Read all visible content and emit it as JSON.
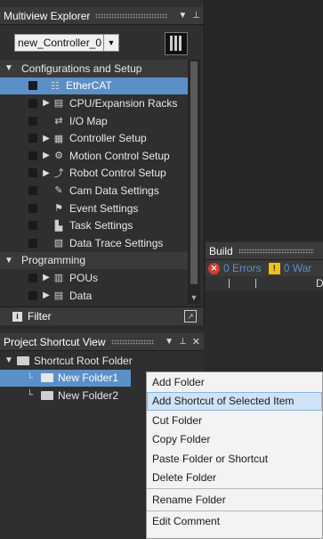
{
  "multiview": {
    "title": "Multiview Explorer",
    "controller_select": "new_Controller_0",
    "items": [
      {
        "label": "Configurations and Setup",
        "kind": "section",
        "arrow": "▼"
      },
      {
        "label": "EtherCAT",
        "kind": "item",
        "icon": "ethercat-icon",
        "glyph": "☷",
        "selected": true
      },
      {
        "label": "CPU/Expansion Racks",
        "kind": "item",
        "icon": "rack-icon",
        "glyph": "▤",
        "arrow": "▶"
      },
      {
        "label": "I/O Map",
        "kind": "item",
        "icon": "io-map-icon",
        "glyph": "⇄"
      },
      {
        "label": "Controller Setup",
        "kind": "item",
        "icon": "controller-setup-icon",
        "glyph": "▦",
        "arrow": "▶"
      },
      {
        "label": "Motion Control Setup",
        "kind": "item",
        "icon": "motion-gear-icon",
        "glyph": "⚙",
        "arrow": "▶"
      },
      {
        "label": "Robot Control Setup",
        "kind": "item",
        "icon": "robot-icon",
        "glyph": "⤴",
        "arrow": "▶"
      },
      {
        "label": "Cam Data Settings",
        "kind": "item",
        "icon": "cam-icon",
        "glyph": "✎"
      },
      {
        "label": "Event Settings",
        "kind": "item",
        "icon": "event-flag-icon",
        "glyph": "⚑"
      },
      {
        "label": "Task Settings",
        "kind": "item",
        "icon": "task-icon",
        "glyph": "▙"
      },
      {
        "label": "Data Trace Settings",
        "kind": "item",
        "icon": "data-trace-icon",
        "glyph": "▧"
      },
      {
        "label": "Programming",
        "kind": "section",
        "arrow": "▼"
      },
      {
        "label": "POUs",
        "kind": "item",
        "icon": "pou-icon",
        "glyph": "▥",
        "arrow": "▶"
      },
      {
        "label": "Data",
        "kind": "item",
        "icon": "data-icon",
        "glyph": "▤",
        "arrow": "▶"
      }
    ],
    "filter_label": "Filter"
  },
  "build": {
    "title": "Build",
    "errors_label": "0 Errors",
    "warnings_label": "0 War",
    "col_d": "D"
  },
  "shortcut_view": {
    "title": "Project Shortcut View",
    "root_label": "Shortcut Root Folder",
    "folder1": "New Folder1",
    "folder2": "New Folder2"
  },
  "context_menu": {
    "items": [
      {
        "label": "Add Folder"
      },
      {
        "label": "Add Shortcut of Selected Item",
        "highlighted": true
      },
      {
        "label": "Cut Folder"
      },
      {
        "label": "Copy Folder"
      },
      {
        "label": "Paste Folder or Shortcut"
      },
      {
        "label": "Delete Folder",
        "sep_after": true
      },
      {
        "label": "Rename Folder",
        "sep_after": true
      },
      {
        "label": "Edit Comment"
      }
    ]
  }
}
